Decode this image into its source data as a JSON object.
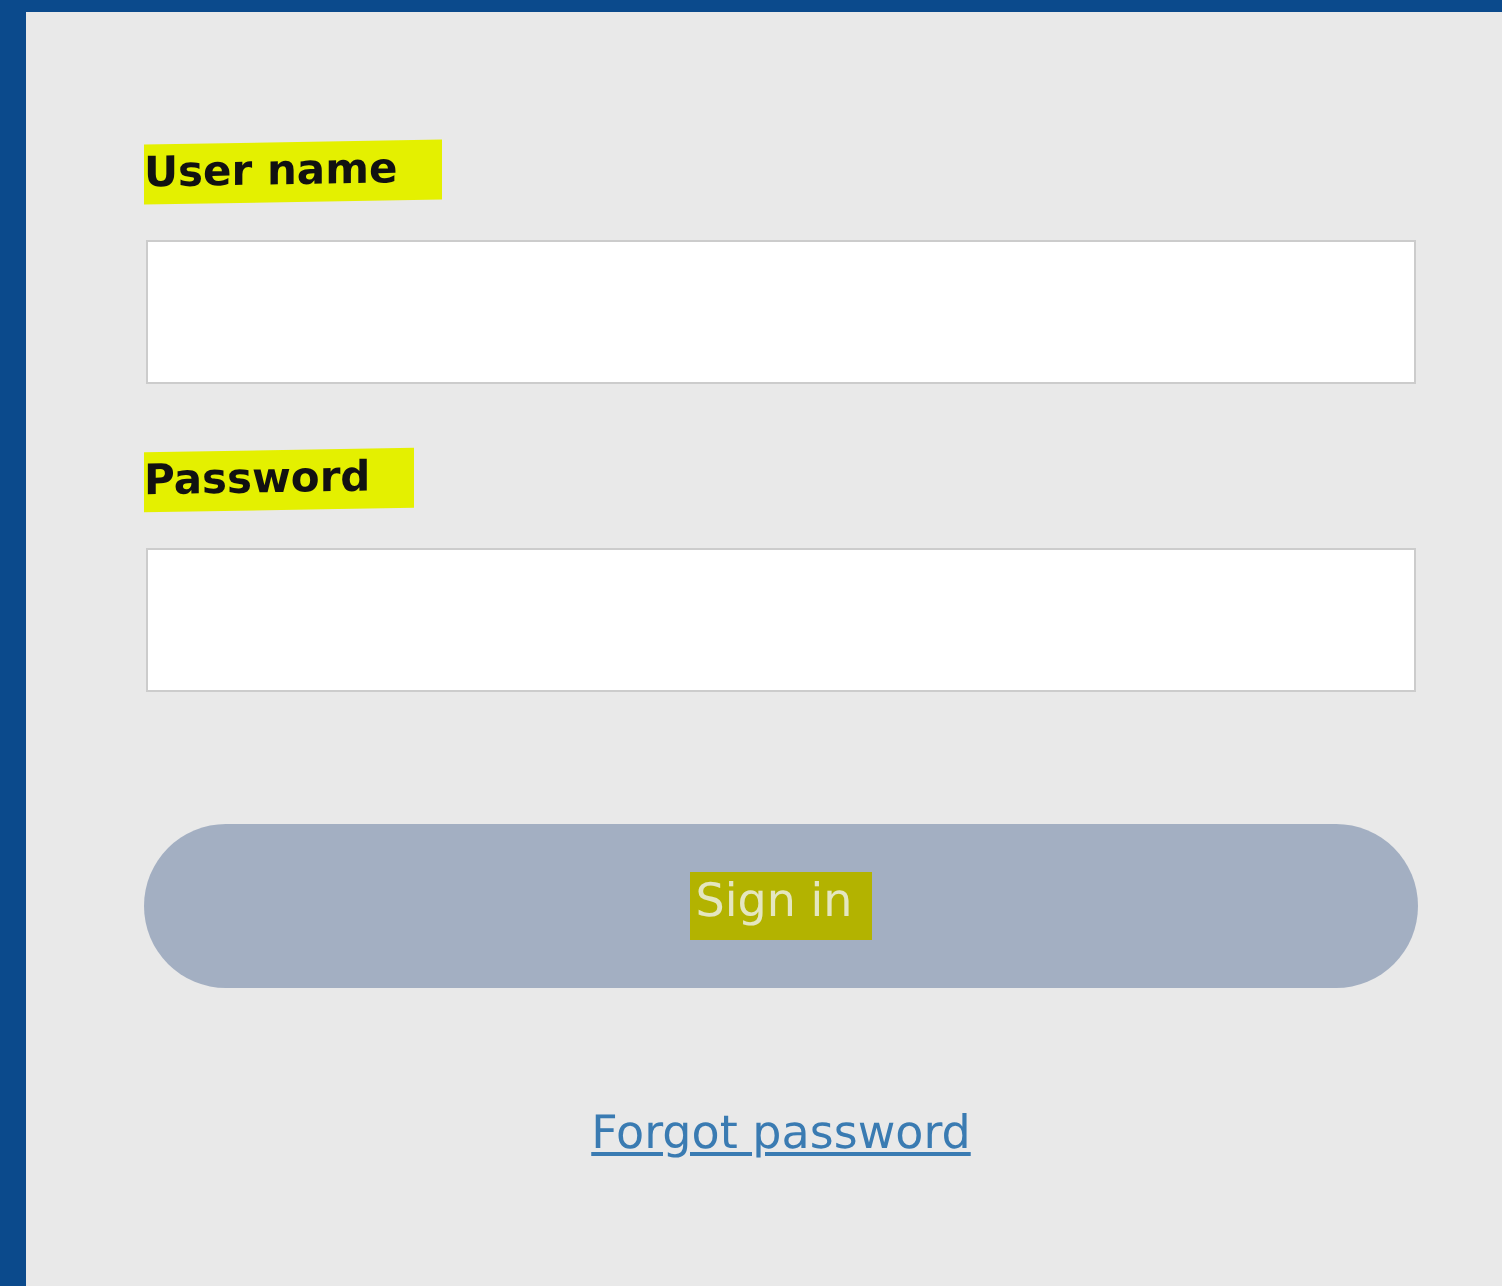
{
  "fields": [
    {
      "label": "User name",
      "highlighted": true
    },
    {
      "label": "Password",
      "highlighted": true
    }
  ],
  "sign_in_button": {
    "label": "Sign in",
    "highlighted": true,
    "disabled": true
  },
  "forgot_link": {
    "label": "Forgot password"
  }
}
